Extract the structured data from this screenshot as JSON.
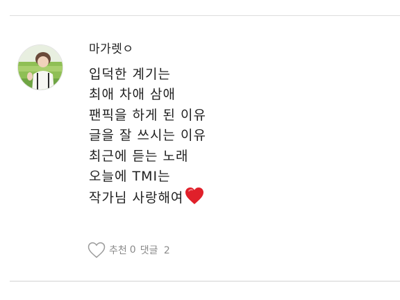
{
  "comment": {
    "author": "마가렛ㅇ",
    "lines": [
      "입덕한 계기는",
      "최애 차애 삼애",
      "팬픽을 하게 된 이유",
      "글을 잘 쓰시는 이유",
      "최근에 듣는 노래",
      "오늘에 TMI는",
      "작가님 사랑해여"
    ],
    "heart_emoji_color": "#e0202a"
  },
  "footer": {
    "like_label": "추천",
    "like_count": "0",
    "reply_label": "댓글",
    "reply_count": "2"
  },
  "colors": {
    "text": "#1f1f1f",
    "muted": "#8a8a8a",
    "divider": "#dcdcdc"
  }
}
